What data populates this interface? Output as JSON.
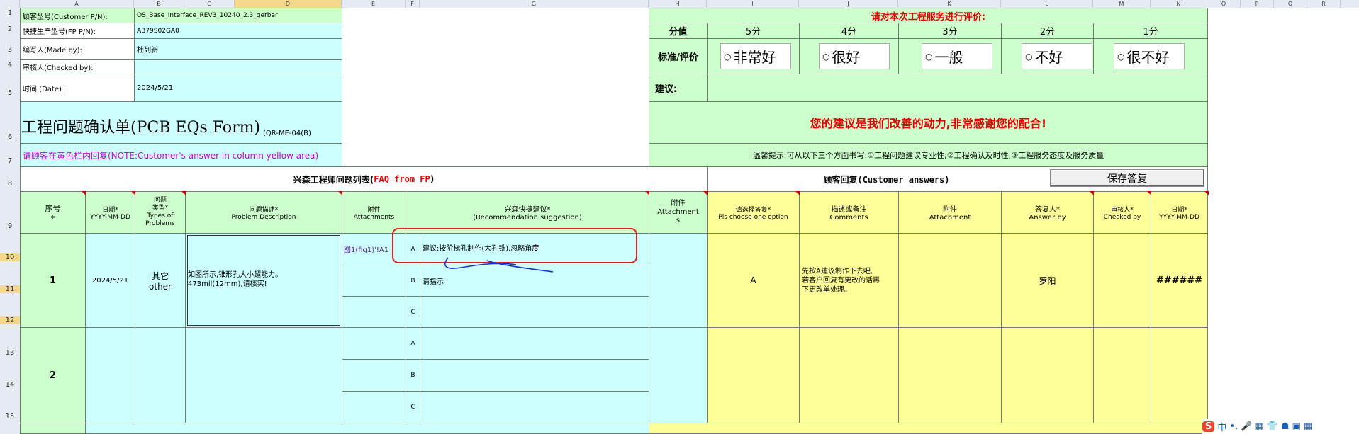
{
  "columns": [
    "A",
    "B",
    "C",
    "D",
    "E",
    "F",
    "G",
    "H",
    "I",
    "J",
    "K",
    "L",
    "M",
    "N",
    "O",
    "P",
    "Q",
    "R"
  ],
  "rows": [
    "1",
    "2",
    "3",
    "4",
    "5",
    "6",
    "7",
    "8",
    "9",
    "10",
    "11",
    "12",
    "13",
    "14",
    "15"
  ],
  "info": {
    "customer_pn_label": "顾客型号(Customer P/N):",
    "customer_pn_value": "OS_Base_Interface_REV3_10240_2.3_gerber",
    "fp_pn_label": "快捷生产型号(FP P/N):",
    "fp_pn_value": "AB79S02GA0",
    "made_by_label": "编写人(Made by):",
    "made_by_value": "杜列新",
    "checked_by_label": "审核人(Checked by):",
    "date_label": "时间 (Date) :",
    "date_value": "2024/5/21"
  },
  "form_title": "工程问题确认单(PCB EQs Form)",
  "form_code": "(QR-ME-04(B)",
  "yellow_note": "请顾客在黄色栏内回复(NOTE:Customer's answer in column yellow area)",
  "rating": {
    "title": "请对本次工程服务进行评价:",
    "score_label": "分值",
    "scores": [
      "5分",
      "4分",
      "3分",
      "2分",
      "1分"
    ],
    "standard_label": "标准/评价",
    "options": [
      "非常好",
      "很好",
      "一般",
      "不好",
      "很不好"
    ],
    "suggestion_label": "建议:",
    "thanks": "您的建议是我们改善的动力,非常感谢您的配合!",
    "tip": "温馨提示:可从以下三个方面书写:①工程问题建议专业性;②工程确认及时性;③工程服务态度及服务质量"
  },
  "section": {
    "fp_title_prefix": "兴森工程师问题列表(",
    "fp_title_en": "FAQ from FP",
    "fp_title_suffix": ")",
    "cust_title": "顾客回复(Customer answers)",
    "save_button": "保存答复"
  },
  "headers": {
    "seq": "序号\n*",
    "date": "日期*\nYYYY-MM-DD",
    "type": "问题\n类型*\nTypes of\nProblems",
    "desc": "问题描述*\nProblem Description",
    "attach": "附件\nAttachments",
    "recommend": "兴森快捷建议*\n(Recommendation,suggestion)",
    "attach2": "附件\nAttachment\ns",
    "choose": "请选择答复*\nPls choose one option",
    "comments": "描述或备注\nComments",
    "cust_attach": "附件\nAttachment",
    "answer_by": "答复人*\nAnswer by",
    "checked_by": "审核人*\nChecked by",
    "cust_date": "日期*\nYYYY-MM-DD"
  },
  "issues": [
    {
      "seq": "1",
      "date": "2024/5/21",
      "type": "其它\nother",
      "desc": "如图所示,锥形孔大小超能力。\n473mil(12mm),请核实!",
      "attachment": "图1(fig1)'!A1",
      "options": [
        {
          "key": "A",
          "text": "建议:按阶梯孔制作(大孔铣),忽略角度"
        },
        {
          "key": "B",
          "text": "请指示"
        },
        {
          "key": "C",
          "text": ""
        }
      ],
      "choice": "A",
      "comment": "先按A建议制作下去吧,\n若客户回复有更改的话再\n下更改单处理。",
      "answer_by": "罗阳",
      "cust_date": "######"
    },
    {
      "seq": "2",
      "options": [
        {
          "key": "A",
          "text": ""
        },
        {
          "key": "B",
          "text": ""
        },
        {
          "key": "C",
          "text": ""
        }
      ]
    }
  ],
  "taskbar": [
    "S",
    "中",
    "•,",
    "🎤",
    "▦",
    "👕",
    "☗",
    "▣",
    "▦"
  ]
}
